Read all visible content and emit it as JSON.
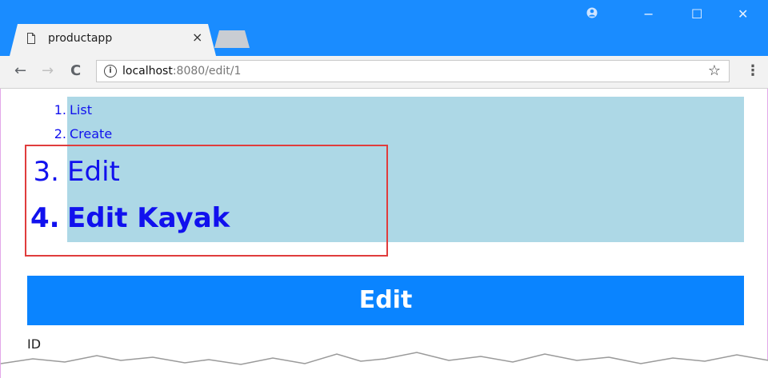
{
  "browser": {
    "tab_title": "productapp",
    "tab_close": "×",
    "url_host": "localhost",
    "url_rest": ":8080/edit/1",
    "window_controls": {
      "account": "●",
      "minimize": "−",
      "maximize": "☐",
      "close": "✕"
    },
    "nav": {
      "back": "←",
      "forward": "→",
      "reload": "C"
    },
    "info_icon": "i",
    "star": "☆",
    "menu": "⋮",
    "accent_color": "#1a8cff"
  },
  "breadcrumb": {
    "items": [
      {
        "number": "1.",
        "label": "List"
      },
      {
        "number": "2.",
        "label": "Create"
      },
      {
        "number": "3.",
        "label": "Edit"
      },
      {
        "number": "4.",
        "label": "Edit Kayak"
      }
    ],
    "background_color": "#add8e6",
    "link_color": "#1111ee"
  },
  "highlight_color": "#e03c3c",
  "heading": {
    "label": "Edit",
    "color": "#0a84ff"
  },
  "form": {
    "first_field_label": "ID"
  }
}
